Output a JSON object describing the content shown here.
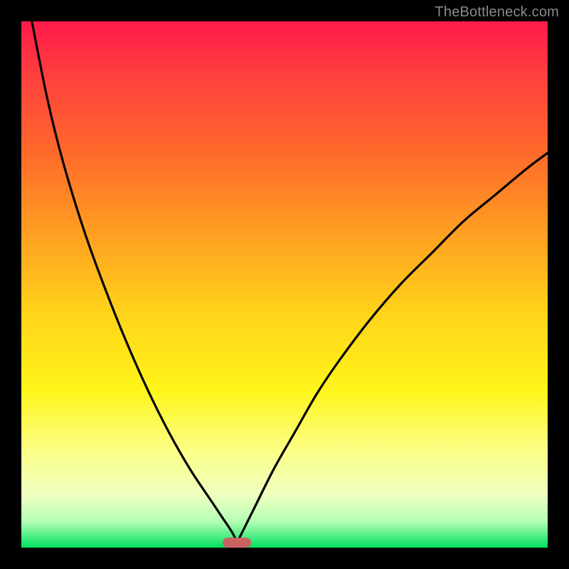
{
  "watermark": "TheBottleneck.com",
  "colors": {
    "curve": "#000000",
    "marker": "#c96262",
    "frame": "#000000"
  },
  "chart_data": {
    "type": "line",
    "title": "",
    "xlabel": "",
    "ylabel": "",
    "xlim": [
      0,
      100
    ],
    "ylim": [
      0,
      100
    ],
    "grid": false,
    "legend": false,
    "annotations": [
      {
        "kind": "marker",
        "x": 41,
        "y": 99,
        "shape": "pill",
        "color": "#c96262"
      }
    ],
    "series": [
      {
        "name": "left-curve",
        "x": [
          2,
          5,
          8,
          12,
          16,
          20,
          24,
          28,
          32,
          36,
          38,
          40,
          41
        ],
        "values": [
          0,
          15,
          27,
          40,
          51,
          61,
          70,
          78,
          85,
          91,
          94,
          97,
          99
        ]
      },
      {
        "name": "right-curve",
        "x": [
          41,
          44,
          48,
          52,
          56,
          60,
          66,
          72,
          78,
          84,
          90,
          96,
          100
        ],
        "values": [
          99,
          93,
          85,
          78,
          71,
          65,
          57,
          50,
          44,
          38,
          33,
          28,
          25
        ]
      }
    ]
  }
}
